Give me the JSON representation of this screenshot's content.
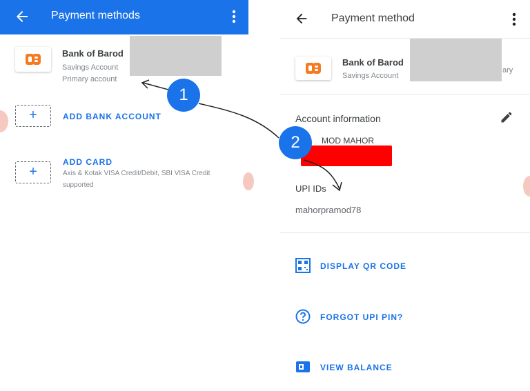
{
  "left_screen": {
    "title": "Payment methods",
    "bank": {
      "name": "Bank of Barod",
      "account_type": "Savings Account",
      "primary": "Primary account"
    },
    "add_bank": {
      "label": "ADD BANK ACCOUNT"
    },
    "add_card": {
      "label": "ADD CARD",
      "description": "Axis & Kotak VISA Credit/Debit, SBI VISA Credit supported"
    }
  },
  "right_screen": {
    "title": "Payment method",
    "bank": {
      "name": "Bank of Barod",
      "account_type": "Savings Account",
      "primary_suffix": "ary"
    },
    "account_info": {
      "title": "Account information",
      "holder_name": "MOD MAHOR"
    },
    "upi": {
      "title": "UPI IDs",
      "id": "mahorpramod78"
    },
    "actions": [
      {
        "label": "DISPLAY QR CODE",
        "icon": "qr-code-icon"
      },
      {
        "label": "FORGOT UPI PIN?",
        "icon": "help-circle-icon"
      },
      {
        "label": "VIEW BALANCE",
        "icon": "wallet-icon"
      }
    ]
  },
  "annotations": {
    "marker_1": "1",
    "marker_2": "2"
  },
  "colors": {
    "accent": "#1a73e8",
    "bank_logo": "#f47b20",
    "redaction_red": "#ff0000",
    "redaction_grey": "#cfcfcf"
  }
}
